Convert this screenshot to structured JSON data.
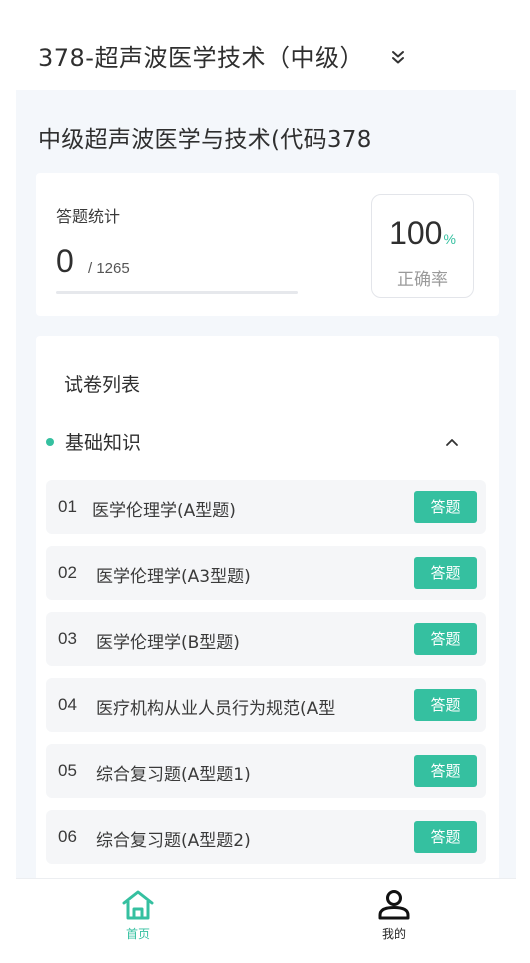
{
  "header": {
    "title": "378-超声波医学技术（中级）",
    "toggle_icon": "double-chevron-down-icon"
  },
  "subject": {
    "title": "中级超声波医学与技术(代码378"
  },
  "stats": {
    "label": "答题统计",
    "answered": "0",
    "total": "/ 1265",
    "progress_fraction": 0,
    "accuracy_value": "100",
    "accuracy_unit": "%",
    "accuracy_label": "正确率"
  },
  "paper_list": {
    "title": "试卷列表",
    "section": {
      "label": "基础知识",
      "toggle_icon": "chevron-up-icon"
    },
    "items": [
      {
        "num": "01",
        "name": "医学伦理学(A型题)",
        "button": "答题"
      },
      {
        "num": "02",
        "name": "医学伦理学(A3型题)",
        "button": "答题"
      },
      {
        "num": "03",
        "name": "医学伦理学(B型题)",
        "button": "答题"
      },
      {
        "num": "04",
        "name": "医疗机构从业人员行为规范(A型",
        "button": "答题"
      },
      {
        "num": "05",
        "name": "综合复习题(A型题1)",
        "button": "答题"
      },
      {
        "num": "06",
        "name": "综合复习题(A型题2)",
        "button": "答题"
      }
    ]
  },
  "tabbar": {
    "home": {
      "label": "首页",
      "icon": "home-icon"
    },
    "mine": {
      "label": "我的",
      "icon": "user-icon"
    }
  },
  "colors": {
    "accent": "#35c0a0",
    "page_bg": "#f4f7fb"
  }
}
